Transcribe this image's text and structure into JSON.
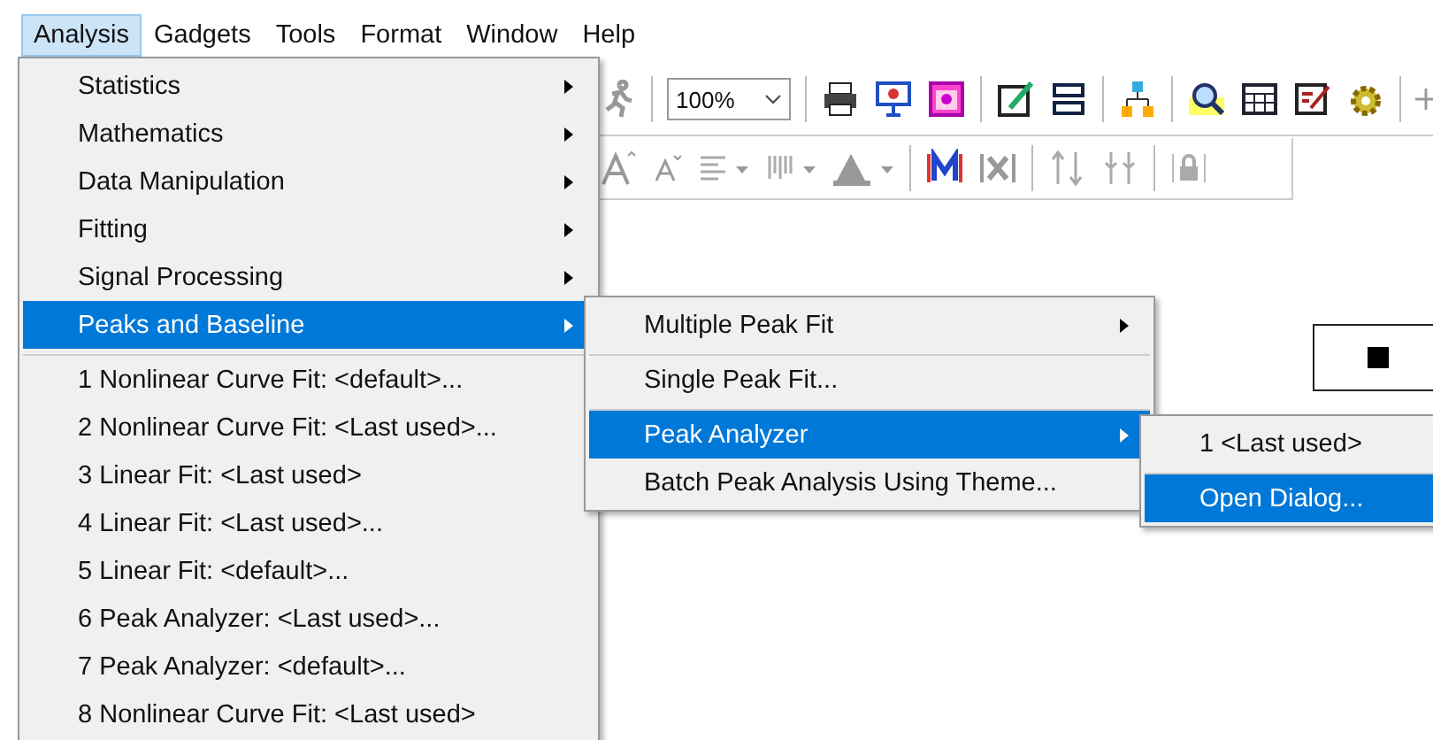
{
  "menubar": [
    {
      "label": "Analysis",
      "selected": true
    },
    {
      "label": "Gadgets",
      "selected": false
    },
    {
      "label": "Tools",
      "selected": false
    },
    {
      "label": "Format",
      "selected": false
    },
    {
      "label": "Window",
      "selected": false
    },
    {
      "label": "Help",
      "selected": false
    }
  ],
  "toolbar": {
    "zoom": "100%"
  },
  "analysis_menu": [
    {
      "label": "Statistics",
      "submenu": true,
      "selected": false,
      "separator_after": false
    },
    {
      "label": "Mathematics",
      "submenu": true,
      "selected": false,
      "separator_after": false
    },
    {
      "label": "Data Manipulation",
      "submenu": true,
      "selected": false,
      "separator_after": false
    },
    {
      "label": "Fitting",
      "submenu": true,
      "selected": false,
      "separator_after": false
    },
    {
      "label": "Signal Processing",
      "submenu": true,
      "selected": false,
      "separator_after": false
    },
    {
      "label": "Peaks and Baseline",
      "submenu": true,
      "selected": true,
      "separator_after": true
    },
    {
      "label": "1 Nonlinear Curve Fit: <default>...",
      "submenu": false,
      "selected": false,
      "separator_after": false
    },
    {
      "label": "2 Nonlinear Curve Fit: <Last used>...",
      "submenu": false,
      "selected": false,
      "separator_after": false
    },
    {
      "label": "3 Linear Fit: <Last used>",
      "submenu": false,
      "selected": false,
      "separator_after": false
    },
    {
      "label": "4 Linear Fit: <Last used>...",
      "submenu": false,
      "selected": false,
      "separator_after": false
    },
    {
      "label": "5 Linear Fit: <default>...",
      "submenu": false,
      "selected": false,
      "separator_after": false
    },
    {
      "label": "6 Peak Analyzer: <Last used>...",
      "submenu": false,
      "selected": false,
      "separator_after": false
    },
    {
      "label": "7 Peak Analyzer: <default>...",
      "submenu": false,
      "selected": false,
      "separator_after": false
    },
    {
      "label": "8 Nonlinear Curve Fit: <Last used>",
      "submenu": false,
      "selected": false,
      "separator_after": false
    }
  ],
  "peaks_menu": [
    {
      "label": "Multiple Peak Fit",
      "submenu": true,
      "selected": false,
      "separator_after": true
    },
    {
      "label": "Single Peak Fit...",
      "submenu": false,
      "selected": false,
      "separator_after": true
    },
    {
      "label": "Peak Analyzer",
      "submenu": true,
      "selected": true,
      "separator_after": false
    },
    {
      "label": "Batch Peak Analysis Using Theme...",
      "submenu": false,
      "selected": false,
      "separator_after": false
    }
  ],
  "peak_analyzer_menu": [
    {
      "label": "1 <Last used>",
      "submenu": false,
      "selected": false,
      "separator_after": true
    },
    {
      "label": "Open Dialog...",
      "submenu": false,
      "selected": true,
      "separator_after": false
    }
  ]
}
